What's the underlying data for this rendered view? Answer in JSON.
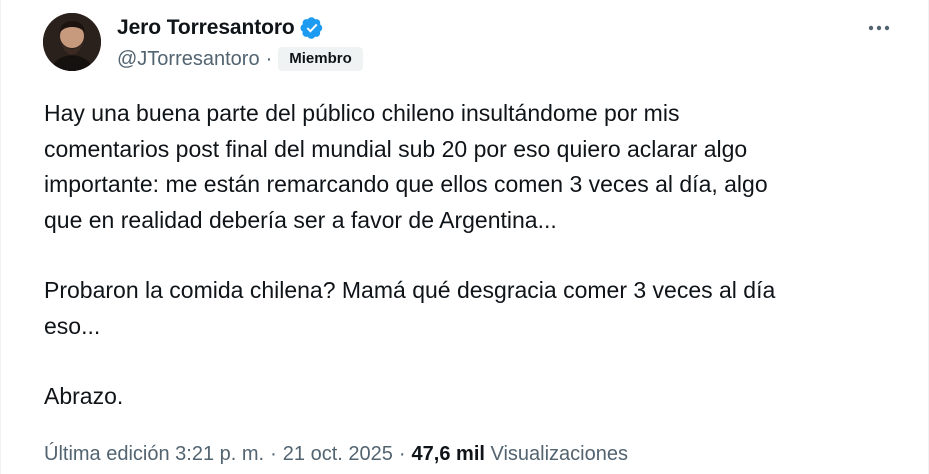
{
  "author": {
    "display_name": "Jero Torresantoro",
    "handle": "@JTorresantoro",
    "badge": "Miembro",
    "verified_icon": "verified-badge-icon",
    "verified_color": "#1d9bf0"
  },
  "tweet": {
    "paragraph1": "Hay una buena parte del público chileno insultándome por mis\ncomentarios post final del mundial sub 20 por eso quiero aclarar algo\nimportante: me están remarcando que ellos comen 3 veces al día, algo\nque en realidad debería ser a favor de Argentina...",
    "paragraph2": "Probaron la comida chilena? Mamá qué desgracia comer 3 veces al día\neso...",
    "paragraph3": "Abrazo."
  },
  "meta": {
    "edited_label": "Última edición",
    "time": "3:21 p. m.",
    "date": "21 oct. 2025",
    "views_count": "47,6 mil",
    "views_label": "Visualizaciones"
  },
  "icons": {
    "more": "more-horizontal-icon"
  }
}
